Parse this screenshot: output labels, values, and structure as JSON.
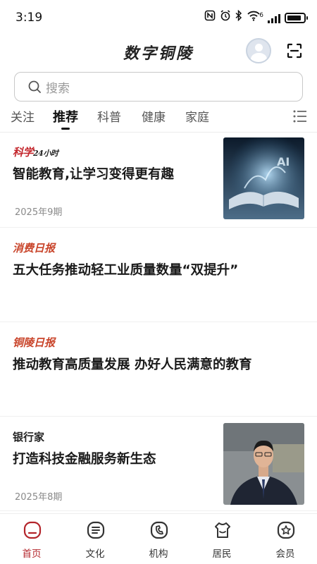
{
  "status_bar": {
    "time": "3:19",
    "network_label": "6",
    "battery_level": 0.85
  },
  "header": {
    "app_title": "数字铜陵",
    "avatar_icon": "user-avatar-icon",
    "scan_icon": "scan-icon"
  },
  "search": {
    "placeholder": "搜索",
    "icon": "search-icon"
  },
  "tabs": [
    {
      "label": "关注",
      "active": false
    },
    {
      "label": "推荐",
      "active": true
    },
    {
      "label": "科普",
      "active": false
    },
    {
      "label": "健康",
      "active": false
    },
    {
      "label": "家庭",
      "active": false
    }
  ],
  "feed": {
    "articles": [
      {
        "source_prefix": "科学",
        "source_suffix": "24小时",
        "title": "智能教育,让学习变得更有趣",
        "date": "2025年9期",
        "has_thumbnail": true
      },
      {
        "source": "消费日报",
        "title": "五大任务推动轻工业质量数量“双提升”",
        "date": "",
        "has_thumbnail": false
      },
      {
        "source": "铜陵日报",
        "title": "推动教育高质量发展 办好人民满意的教育",
        "date": "",
        "has_thumbnail": false
      },
      {
        "source": "银行家",
        "title": "打造科技金融服务新生态",
        "date": "2025年8期",
        "has_thumbnail": true
      }
    ]
  },
  "bottom_nav": [
    {
      "label": "首页",
      "icon": "home-icon",
      "active": true
    },
    {
      "label": "文化",
      "icon": "culture-icon",
      "active": false
    },
    {
      "label": "机构",
      "icon": "organization-icon",
      "active": false
    },
    {
      "label": "居民",
      "icon": "resident-icon",
      "active": false
    },
    {
      "label": "会员",
      "icon": "member-icon",
      "active": false
    }
  ],
  "colors": {
    "accent": "#b3252b",
    "source_red": "#c9452b",
    "divider": "#ececec"
  }
}
